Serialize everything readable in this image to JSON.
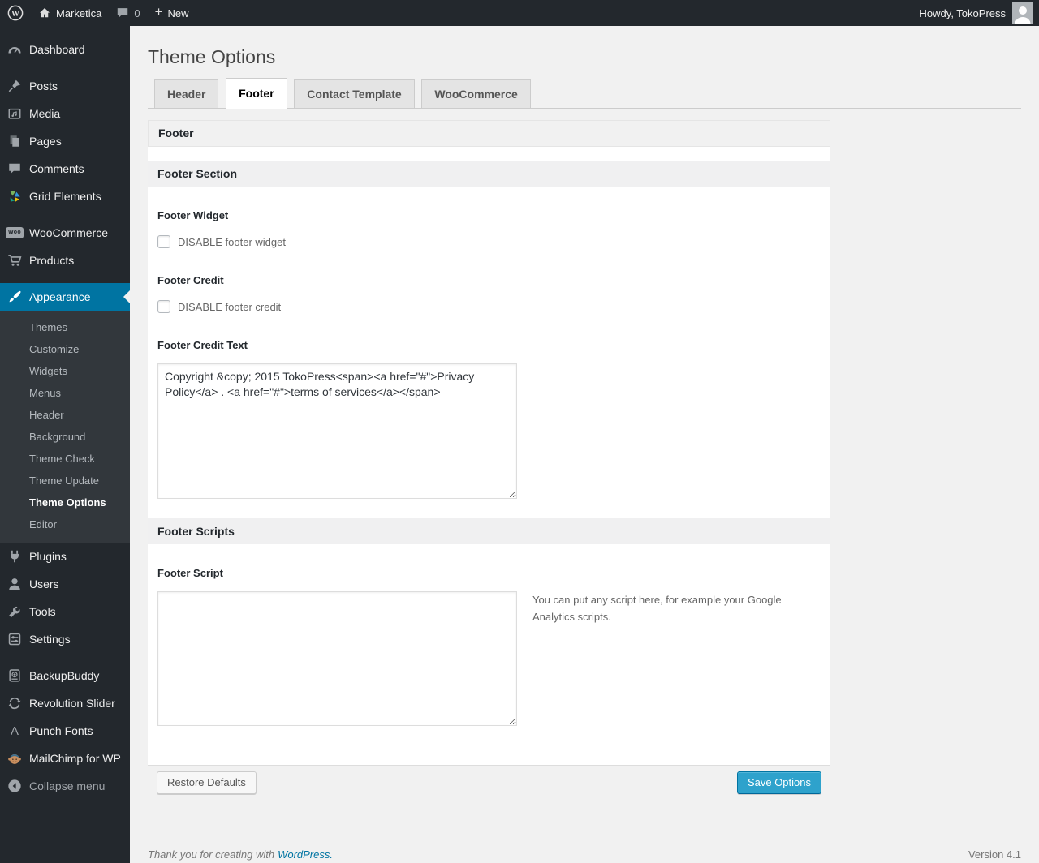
{
  "admin_bar": {
    "site_name": "Marketica",
    "comment_count": "0",
    "new_label": "New",
    "howdy": "Howdy, TokoPress"
  },
  "icons": {
    "plus": "+",
    "punch_fonts": "A",
    "woo_badge": "Woo"
  },
  "sidebar": {
    "items": [
      {
        "label": "Dashboard"
      },
      {
        "label": "Posts"
      },
      {
        "label": "Media"
      },
      {
        "label": "Pages"
      },
      {
        "label": "Comments"
      },
      {
        "label": "Grid Elements"
      },
      {
        "label": "WooCommerce"
      },
      {
        "label": "Products"
      },
      {
        "label": "Appearance"
      },
      {
        "label": "Plugins"
      },
      {
        "label": "Users"
      },
      {
        "label": "Tools"
      },
      {
        "label": "Settings"
      },
      {
        "label": "BackupBuddy"
      },
      {
        "label": "Revolution Slider"
      },
      {
        "label": "Punch Fonts"
      },
      {
        "label": "MailChimp for WP"
      },
      {
        "label": "Collapse menu"
      }
    ],
    "appearance_submenu": [
      {
        "label": "Themes"
      },
      {
        "label": "Customize"
      },
      {
        "label": "Widgets"
      },
      {
        "label": "Menus"
      },
      {
        "label": "Header"
      },
      {
        "label": "Background"
      },
      {
        "label": "Theme Check"
      },
      {
        "label": "Theme Update"
      },
      {
        "label": "Theme Options"
      },
      {
        "label": "Editor"
      }
    ]
  },
  "page": {
    "title": "Theme Options",
    "tabs": [
      {
        "label": "Header"
      },
      {
        "label": "Footer"
      },
      {
        "label": "Contact Template"
      },
      {
        "label": "WooCommerce"
      }
    ],
    "panel": {
      "group_title": "Footer",
      "section1_title": "Footer Section",
      "footer_widget_label": "Footer Widget",
      "footer_widget_checkbox": "DISABLE footer widget",
      "footer_credit_label": "Footer Credit",
      "footer_credit_checkbox": "DISABLE footer credit",
      "footer_credit_text_label": "Footer Credit Text",
      "footer_credit_text_value": "Copyright &copy; 2015 TokoPress<span><a href=\"#\">Privacy Policy</a> . <a href=\"#\">terms of services</a></span>",
      "section2_title": "Footer Scripts",
      "footer_script_label": "Footer Script",
      "footer_script_value": "",
      "footer_script_help": "You can put any script here, for example your Google Analytics scripts.",
      "restore_button": "Restore Defaults",
      "save_button": "Save Options"
    }
  },
  "page_footer": {
    "thanks_text": "Thank you for creating with",
    "wordpress_link": "WordPress.",
    "version": "Version 4.1"
  },
  "colors": {
    "accent_blue": "#0074a2",
    "button_primary": "#2ea2cc",
    "admin_bar_bg": "#23282d",
    "submenu_bg": "#32373c",
    "page_bg": "#f1f1f1"
  }
}
